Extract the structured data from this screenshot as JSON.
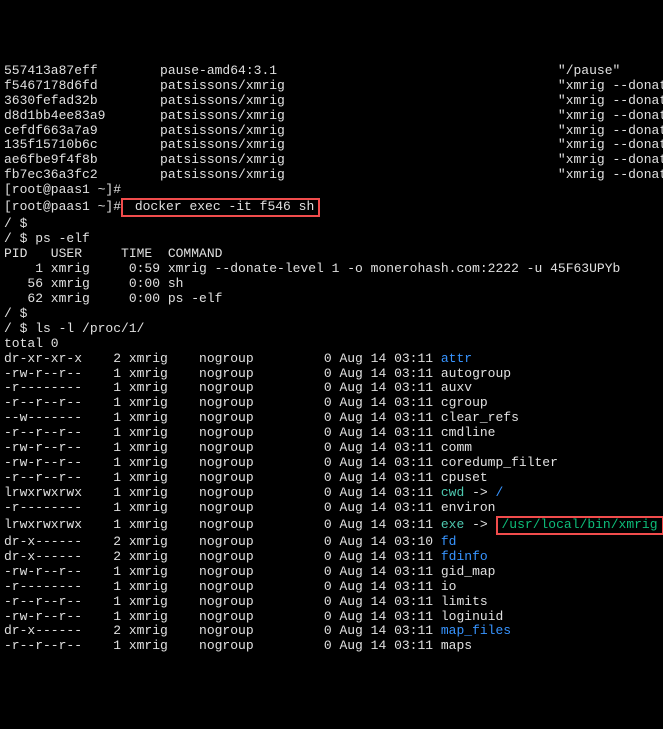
{
  "docker_ps": [
    {
      "id": "557413a87eff",
      "image": "pause-amd64:3.1",
      "cmd": "\"/pause\""
    },
    {
      "id": "f5467178d6fd",
      "image": "patsissons/xmrig",
      "cmd": "\"xmrig --donate-leveâ |\""
    },
    {
      "id": "3630fefad32b",
      "image": "patsissons/xmrig",
      "cmd": "\"xmrig --donate-leveâ |\""
    },
    {
      "id": "d8d1bb4ee83a9",
      "image": "patsissons/xmrig",
      "cmd": "\"xmrig --donate-leveâ |\""
    },
    {
      "id": "cefdf663a7a9",
      "image": "patsissons/xmrig",
      "cmd": "\"xmrig --donate-leveâ |\""
    },
    {
      "id": "135f15710b6c",
      "image": "patsissons/xmrig",
      "cmd": "\"xmrig --donate-leveâ |\""
    },
    {
      "id": "ae6fbe9f4f8b",
      "image": "patsissons/xmrig",
      "cmd": "\"xmrig --donate-leveâ |\""
    },
    {
      "id": "fb7ec36a3fc2",
      "image": "patsissons/xmrig",
      "cmd": "\"xmrig --donate-leveâ |\""
    }
  ],
  "prompt1": "[root@paas1 ~]#",
  "prompt2": "[root@paas1 ~]#",
  "docker_cmd": " docker exec -it f546 sh",
  "shell_prompt": "/ $",
  "ps_cmd": "/ $ ps -elf",
  "ps_header": "PID   USER     TIME  COMMAND",
  "ps_rows": [
    "    1 xmrig     0:59 xmrig --donate-level 1 -o monerohash.com:2222 -u 45F63UPYb",
    "   56 xmrig     0:00 sh",
    "   62 xmrig     0:00 ps -elf"
  ],
  "ls_cmd": "/ $ ls -l /proc/1/",
  "total": "total 0",
  "proc_entries": [
    {
      "perm": "dr-xr-xr-x",
      "n": "2",
      "u": "xmrig",
      "g": "nogroup",
      "s": "0",
      "dt": "Aug 14 03:11",
      "name": "attr",
      "cls": "blue"
    },
    {
      "perm": "-rw-r--r--",
      "n": "1",
      "u": "xmrig",
      "g": "nogroup",
      "s": "0",
      "dt": "Aug 14 03:11",
      "name": "autogroup",
      "cls": ""
    },
    {
      "perm": "-r--------",
      "n": "1",
      "u": "xmrig",
      "g": "nogroup",
      "s": "0",
      "dt": "Aug 14 03:11",
      "name": "auxv",
      "cls": ""
    },
    {
      "perm": "-r--r--r--",
      "n": "1",
      "u": "xmrig",
      "g": "nogroup",
      "s": "0",
      "dt": "Aug 14 03:11",
      "name": "cgroup",
      "cls": ""
    },
    {
      "perm": "--w-------",
      "n": "1",
      "u": "xmrig",
      "g": "nogroup",
      "s": "0",
      "dt": "Aug 14 03:11",
      "name": "clear_refs",
      "cls": ""
    },
    {
      "perm": "-r--r--r--",
      "n": "1",
      "u": "xmrig",
      "g": "nogroup",
      "s": "0",
      "dt": "Aug 14 03:11",
      "name": "cmdline",
      "cls": ""
    },
    {
      "perm": "-rw-r--r--",
      "n": "1",
      "u": "xmrig",
      "g": "nogroup",
      "s": "0",
      "dt": "Aug 14 03:11",
      "name": "comm",
      "cls": ""
    },
    {
      "perm": "-rw-r--r--",
      "n": "1",
      "u": "xmrig",
      "g": "nogroup",
      "s": "0",
      "dt": "Aug 14 03:11",
      "name": "coredump_filter",
      "cls": ""
    },
    {
      "perm": "-r--r--r--",
      "n": "1",
      "u": "xmrig",
      "g": "nogroup",
      "s": "0",
      "dt": "Aug 14 03:11",
      "name": "cpuset",
      "cls": ""
    },
    {
      "perm": "lrwxrwxrwx",
      "n": "1",
      "u": "xmrig",
      "g": "nogroup",
      "s": "0",
      "dt": "Aug 14 03:11",
      "name": "cwd",
      "cls": "cyan",
      "link": " -> ",
      "target": "/",
      "tcls": "blue"
    },
    {
      "perm": "-r--------",
      "n": "1",
      "u": "xmrig",
      "g": "nogroup",
      "s": "0",
      "dt": "Aug 14 03:11",
      "name": "environ",
      "cls": ""
    },
    {
      "perm": "lrwxrwxrwx",
      "n": "1",
      "u": "xmrig",
      "g": "nogroup",
      "s": "0",
      "dt": "Aug 14 03:11",
      "name": "exe",
      "cls": "cyan",
      "link": " -> ",
      "target": "/usr/local/bin/xmrig",
      "tcls": "green",
      "hl": true
    },
    {
      "perm": "dr-x------",
      "n": "2",
      "u": "xmrig",
      "g": "nogroup",
      "s": "0",
      "dt": "Aug 14 03:10",
      "name": "fd",
      "cls": "blue"
    },
    {
      "perm": "dr-x------",
      "n": "2",
      "u": "xmrig",
      "g": "nogroup",
      "s": "0",
      "dt": "Aug 14 03:11",
      "name": "fdinfo",
      "cls": "blue"
    },
    {
      "perm": "-rw-r--r--",
      "n": "1",
      "u": "xmrig",
      "g": "nogroup",
      "s": "0",
      "dt": "Aug 14 03:11",
      "name": "gid_map",
      "cls": ""
    },
    {
      "perm": "-r--------",
      "n": "1",
      "u": "xmrig",
      "g": "nogroup",
      "s": "0",
      "dt": "Aug 14 03:11",
      "name": "io",
      "cls": ""
    },
    {
      "perm": "-r--r--r--",
      "n": "1",
      "u": "xmrig",
      "g": "nogroup",
      "s": "0",
      "dt": "Aug 14 03:11",
      "name": "limits",
      "cls": ""
    },
    {
      "perm": "-rw-r--r--",
      "n": "1",
      "u": "xmrig",
      "g": "nogroup",
      "s": "0",
      "dt": "Aug 14 03:11",
      "name": "loginuid",
      "cls": ""
    },
    {
      "perm": "dr-x------",
      "n": "2",
      "u": "xmrig",
      "g": "nogroup",
      "s": "0",
      "dt": "Aug 14 03:11",
      "name": "map_files",
      "cls": "blue"
    },
    {
      "perm": "-r--r--r--",
      "n": "1",
      "u": "xmrig",
      "g": "nogroup",
      "s": "0",
      "dt": "Aug 14 03:11",
      "name": "maps",
      "cls": ""
    }
  ]
}
